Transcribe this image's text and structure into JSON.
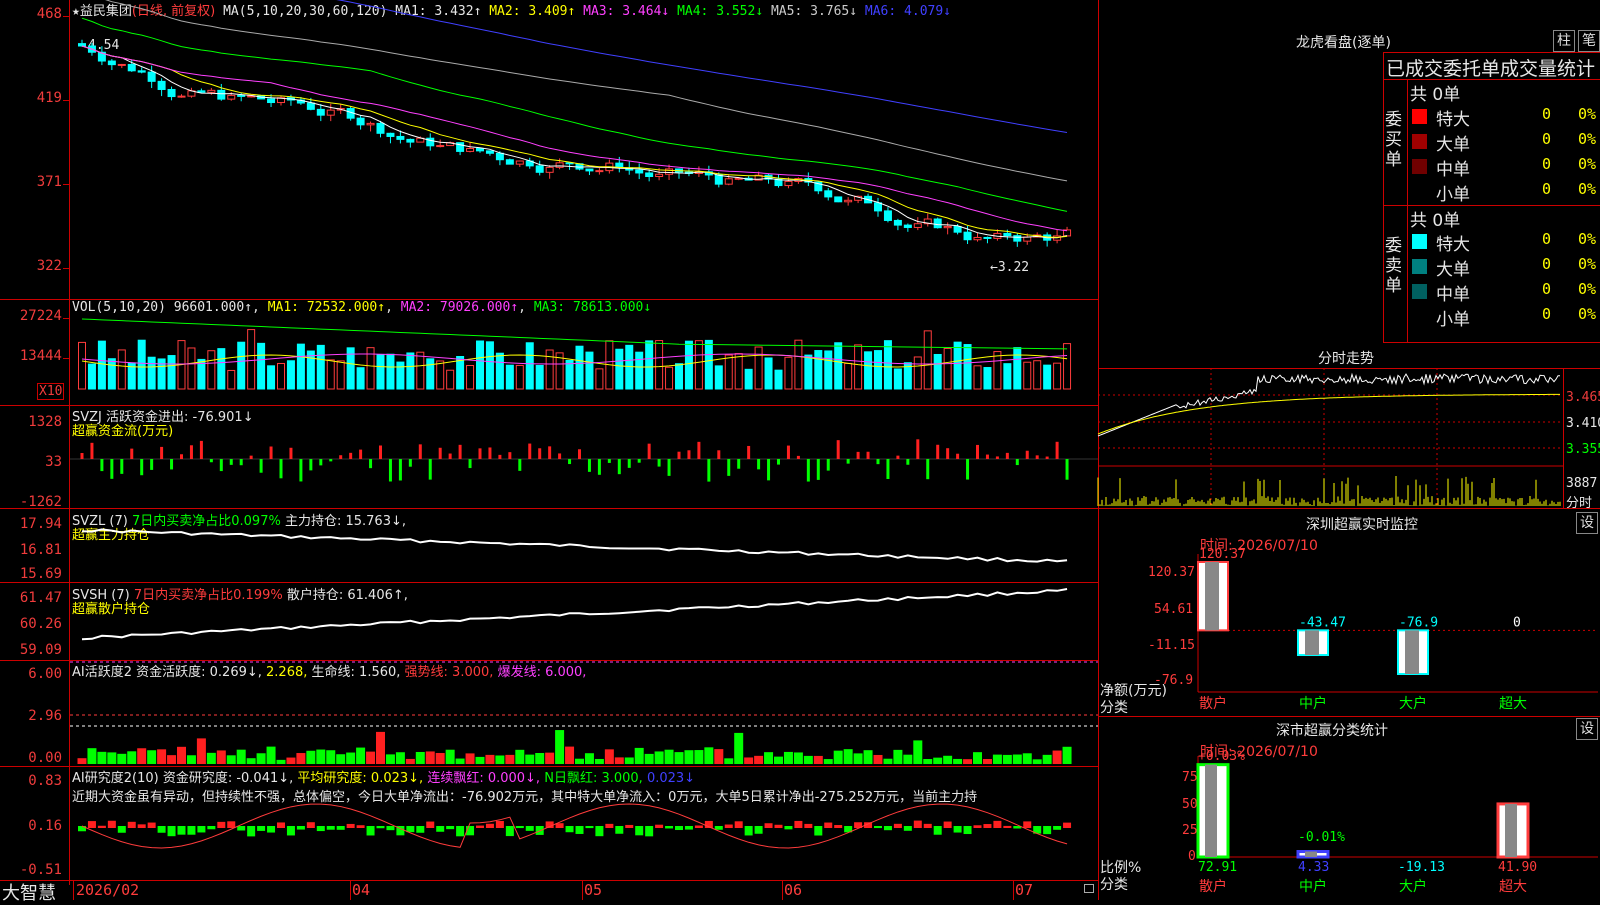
{
  "main": {
    "star": "★",
    "name": "益民集团",
    "period": "(日线, 前复权)",
    "ma_label": "MA(5,10,20,30,60,120)",
    "ma_items": [
      {
        "text": "MA1: 3.432↑",
        "color": "#ffffff"
      },
      {
        "text": "MA2: 3.409↑",
        "color": "#ffff00"
      },
      {
        "text": "MA3: 3.464↓",
        "color": "#ff40ff"
      },
      {
        "text": "MA4: 3.552↓",
        "color": "#00ff00"
      },
      {
        "text": "MA5: 3.765↓",
        "color": "#cccccc"
      },
      {
        "text": "MA6: 4.079↓",
        "color": "#4040ff"
      }
    ],
    "y_ticks": [
      "468",
      "419",
      "371",
      "322"
    ],
    "high_label": "4.54",
    "low_label": "←3.22"
  },
  "vol": {
    "header": "VOL(5,10,20)",
    "value": "96601.000↑",
    "items": [
      {
        "text": "MA1: 72532.000↑",
        "color": "#ffff00"
      },
      {
        "text": "MA2: 79026.000↑",
        "color": "#ff40ff"
      },
      {
        "text": "MA3: 78613.000↓",
        "color": "#00ff00"
      }
    ],
    "y_ticks": [
      "27224",
      "13444"
    ],
    "unit": "X10"
  },
  "svzj": {
    "header": "SVZJ  活跃资金进出: -76.901↓",
    "title": "超赢资金流(万元)",
    "y_ticks": [
      "1328",
      "33",
      "-1262"
    ]
  },
  "svzl": {
    "header_a": "SVZL (7)",
    "header_b": "7日内买卖净占比0.097%",
    "header_c": "主力持仓: 15.763↓,",
    "title": "超赢主力持仓",
    "y_ticks": [
      "17.94",
      "16.81",
      "15.69"
    ]
  },
  "svsh": {
    "header_a": "SVSH (7)",
    "header_b": "7日内买卖净占比0.199%",
    "header_c": "散户持仓: 61.406↑,",
    "title": "超赢散户持仓",
    "y_ticks": [
      "61.47",
      "60.26",
      "59.09"
    ]
  },
  "ai1": {
    "header_a": "AI活跃度2 资金活跃度: 0.269↓,",
    "header_b": "2.268,",
    "header_c": "生命线: 1.560,",
    "header_d": "强势线: 3.000,",
    "header_e": "爆发线: 6.000,",
    "y_ticks": [
      "6.00",
      "2.96",
      "0.00"
    ]
  },
  "ai2": {
    "header_a": "AI研究度2(10) 资金研究度: -0.041↓,",
    "header_b": "平均研究度: 0.023↓,",
    "header_c": "连续飘红: 0.000↓,",
    "header_d": "N日飘红: 3.000,",
    "header_e": "0.023↓",
    "commentary": "近期大资金虽有异动，但持续性不强，总体偏空，今日大单净流出：-76.902万元，其中特大单净流入：0万元，大单5日累计净出-275.252万元，当前主力持",
    "y_ticks": [
      "0.83",
      "0.16",
      "-0.51"
    ]
  },
  "xaxis": {
    "brand": "大智慧",
    "labels": [
      "2026/02",
      "04",
      "05",
      "06",
      "07"
    ]
  },
  "right": {
    "lhb_title": "龙虎看盘(逐单)",
    "btn_bar": "柱",
    "btn_pen": "笔",
    "stat_title": "已成交委托单成交量统计",
    "buy_label": "委买单",
    "sell_label": "委卖单",
    "buy_total": "共 0单",
    "sell_total": "共 0单",
    "buy_rows": [
      {
        "name": "特大",
        "count": "0",
        "pct": "0%",
        "color": "#ff0000"
      },
      {
        "name": "大单",
        "count": "0",
        "pct": "0%",
        "color": "#a00000"
      },
      {
        "name": "中单",
        "count": "0",
        "pct": "0%",
        "color": "#700000"
      },
      {
        "name": "小单",
        "count": "0",
        "pct": "0%",
        "color": ""
      }
    ],
    "sell_rows": [
      {
        "name": "特大",
        "count": "0",
        "pct": "0%",
        "color": "#00ffff"
      },
      {
        "name": "大单",
        "count": "0",
        "pct": "0%",
        "color": "#008080"
      },
      {
        "name": "中单",
        "count": "0",
        "pct": "0%",
        "color": "#006060"
      },
      {
        "name": "小单",
        "count": "0",
        "pct": "0%",
        "color": ""
      }
    ],
    "intraday_title": "分时走势",
    "intraday_ticks": [
      "3.465",
      "3.410",
      "3.355"
    ],
    "intraday_vol": "3887",
    "intraday_vol_unit": "分时",
    "monitor_title": "深圳超赢实时监控",
    "monitor_btn": "设",
    "monitor_time": "时间: 2026/07/10",
    "monitor_ticks": [
      "120.37",
      "54.61",
      "-11.15",
      "-76.9"
    ],
    "monitor_ylabel": "净额(万元)",
    "monitor_xlabel": "分类",
    "monitor_cats": [
      "散户",
      "中户",
      "大户",
      "超大"
    ],
    "class_title": "深市超赢分类统计",
    "class_btn": "设",
    "class_time": "时间: 2026/07/10",
    "class_ticks": [
      "75",
      "50",
      "25",
      "0"
    ],
    "class_ylabel": "比例%",
    "class_xlabel": "分类",
    "class_cats": [
      "散户",
      "中户",
      "大户",
      "超大"
    ],
    "class_values": [
      "72.91",
      "4.33",
      "-19.13",
      "41.90"
    ]
  },
  "chart_data": [
    {
      "type": "bar",
      "title": "深圳超赢实时监控",
      "ylabel": "净额(万元)",
      "xlabel": "分类",
      "categories": [
        "散户",
        "中户",
        "大户",
        "超大"
      ],
      "values": [
        120.37,
        -43.47,
        -76.9,
        0
      ],
      "value_labels": [
        "120.37",
        "-43.47",
        "-76.9",
        "0"
      ],
      "ylim": [
        -76.9,
        120.37
      ]
    },
    {
      "type": "bar",
      "title": "深市超赢分类统计",
      "ylabel": "比例%",
      "xlabel": "分类",
      "categories": [
        "散户",
        "中户",
        "大户",
        "超大"
      ],
      "series": [
        {
          "values": [
            72.91,
            4.33,
            -19.13,
            41.9
          ]
        },
        {
          "values": [
            0.03,
            -0.01,
            0,
            0
          ]
        }
      ],
      "top_labels": [
        "+0.03%",
        "-0.01%",
        "",
        ""
      ],
      "ylim": [
        0,
        75
      ]
    }
  ]
}
